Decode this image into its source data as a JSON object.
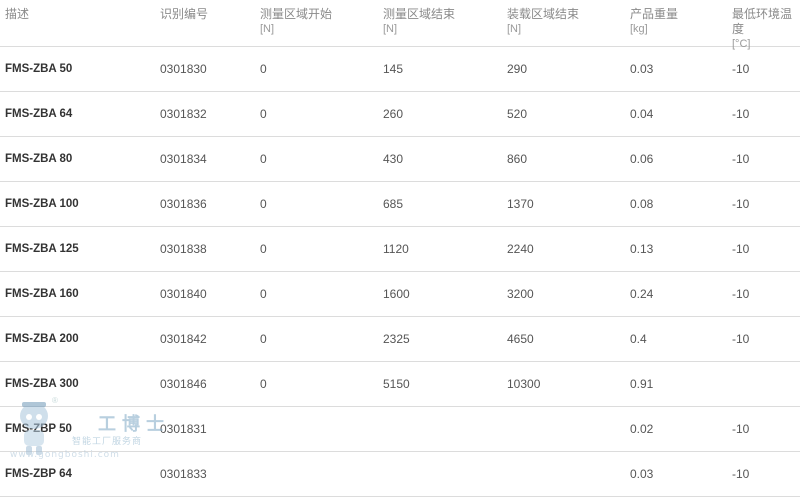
{
  "table": {
    "headers": [
      {
        "label": "描述",
        "unit": ""
      },
      {
        "label": "识别编号",
        "unit": ""
      },
      {
        "label": "测量区域开始",
        "unit": "[N]"
      },
      {
        "label": "测量区域结束",
        "unit": "[N]"
      },
      {
        "label": "装载区域结束",
        "unit": "[N]"
      },
      {
        "label": "产品重量",
        "unit": "[kg]"
      },
      {
        "label": "最低环境温度",
        "unit": "[°C]"
      }
    ],
    "rows": [
      [
        "FMS-ZBA 50",
        "0301830",
        "0",
        "145",
        "290",
        "0.03",
        "-10"
      ],
      [
        "FMS-ZBA 64",
        "0301832",
        "0",
        "260",
        "520",
        "0.04",
        "-10"
      ],
      [
        "FMS-ZBA 80",
        "0301834",
        "0",
        "430",
        "860",
        "0.06",
        "-10"
      ],
      [
        "FMS-ZBA 100",
        "0301836",
        "0",
        "685",
        "1370",
        "0.08",
        "-10"
      ],
      [
        "FMS-ZBA 125",
        "0301838",
        "0",
        "1120",
        "2240",
        "0.13",
        "-10"
      ],
      [
        "FMS-ZBA 160",
        "0301840",
        "0",
        "1600",
        "3200",
        "0.24",
        "-10"
      ],
      [
        "FMS-ZBA 200",
        "0301842",
        "0",
        "2325",
        "4650",
        "0.4",
        "-10"
      ],
      [
        "FMS-ZBA 300",
        "0301846",
        "0",
        "5150",
        "10300",
        "0.91",
        ""
      ],
      [
        "FMS-ZBP 50",
        "0301831",
        "",
        "",
        "",
        "0.02",
        "-10"
      ],
      [
        "FMS-ZBP 64",
        "0301833",
        "",
        "",
        "",
        "0.03",
        "-10"
      ]
    ]
  },
  "watermark": {
    "brand": "工博士",
    "subtitle": "智能工厂服务商",
    "url": "www.gongboshi.com",
    "reg": "®"
  }
}
